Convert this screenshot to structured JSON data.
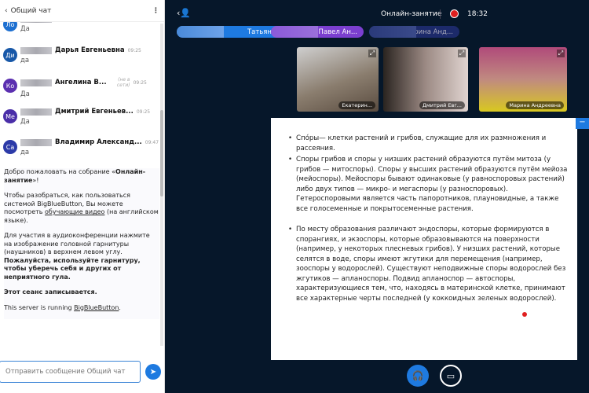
{
  "chat": {
    "title": "Общий чат",
    "messages": [
      {
        "initials": "Ло",
        "name": "",
        "time": "",
        "text": "Да",
        "color": "#1d6fd0"
      },
      {
        "initials": "Ди",
        "name": "Дарья Евгеньевна",
        "time": "09:25",
        "text": "да",
        "color": "#1858a8"
      },
      {
        "initials": "Ко",
        "name": "Ангелина В...",
        "status": "(не в сети)",
        "time": "09:25",
        "text": "Да",
        "color": "#5b2fb0"
      },
      {
        "initials": "Ме",
        "name": "Дмитрий Евгеньев...",
        "time": "09:25",
        "text": "Да",
        "color": "#4a2ea8"
      },
      {
        "initials": "Са",
        "name": "Владимир Александ...",
        "time": "09:47",
        "text": "да",
        "color": "#2c3aa8"
      }
    ],
    "welcome": {
      "p1a": "Добро пожаловать на собрание «",
      "p1b": "Онлайн-занятие",
      "p1c": "»!",
      "p2a": "Чтобы разобраться, как пользоваться системой BigBlueButton, Вы можете посмотреть ",
      "p2link": "обучающие видео",
      "p2b": " (на английском языке).",
      "p3a": "Для участия в аудиоконференции нажмите на изображение головной гарнитуры (наушников) в верхнем левом углу. ",
      "p3b": "Пожалуйста, используйте гарнитуру, чтобы уберечь себя и других от неприятного гула.",
      "p4": "Этот сеанс записывается.",
      "p5a": "This server is running ",
      "p5link": "BigBlueButton",
      "p5b": "."
    },
    "input_placeholder": "Отправить сообщение Общий чат"
  },
  "header": {
    "title": "Онлайн-занятие",
    "time": "18:32"
  },
  "talkers": [
    "Татьяна ...",
    "Павел Ан...",
    "Марина Анд..."
  ],
  "videos": [
    "Екатерин...",
    "Дмитрий Евг...",
    "Марина Андреевна"
  ],
  "slide": {
    "bullets": [
      "Спо́ры— клетки растений и грибов, служащие для их размножения и рассеяния.",
      "Споры грибов и споры у низших растений образуются путём митоза (у грибов — митоспоры). Споры у высших растений образуются путём мейоза (мейоспоры). Мейоспоры бывают одинаковые (у равноспоровых растений) либо двух типов — микро- и мегаспоры (у разноспоровых). Гетероспоровыми является часть папоротников, плауновидные, а также все голосеменные и покрытосеменные растения.",
      "По месту образования различают эндоспоры, которые формируются в спорангиях, и экзоспоры, которые образовываются на поверхности (например, у некоторых плесневых грибов). У низших растений, которые селятся в воде, споры имеют жгутики для перемещения (например, зооспоры у водорослей). Существуют неподвижные споры водорослей без жгутиков — апланоспоры. Подвид апланоспор — автоспоры, характеризующиеся тем, что, находясь в материнской клетке, принимают все характерные черты последней (у коккоидных зеленых водорослей)."
    ]
  }
}
